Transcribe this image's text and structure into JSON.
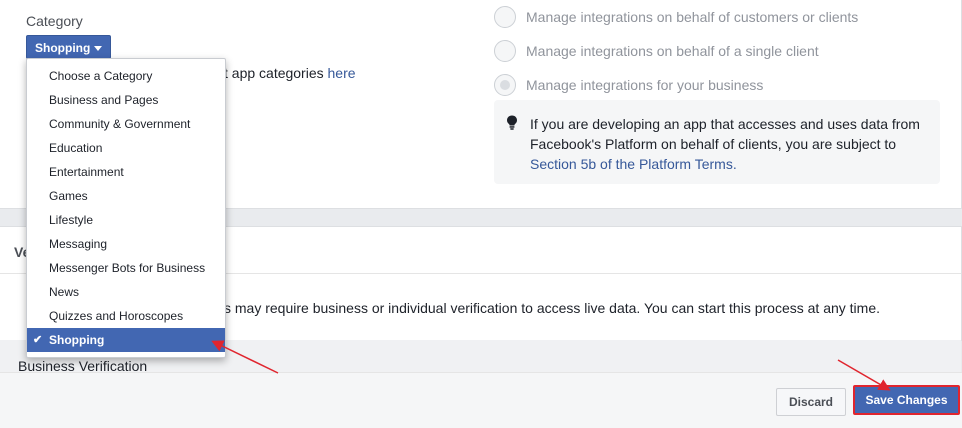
{
  "category": {
    "label": "Category",
    "button_label": "Shopping",
    "learn_more_prefix": "t app categories ",
    "learn_more_link": "here"
  },
  "integrations": {
    "options": [
      "Manage integrations on behalf of customers or clients",
      "Manage integrations on behalf of a single client",
      "Manage integrations for your business"
    ],
    "info_text": "If you are developing an app that accesses and uses data from Facebook's Platform on behalf of clients, you are subject to",
    "info_link": "Section 5b of the Platform Terms."
  },
  "verification": {
    "header_partial": "Ve",
    "text_partial": "s may require business or individual verification to access live data. You can start this process at any time.",
    "business_verification_label": "Business Verification"
  },
  "dropdown": {
    "items": [
      "Choose a Category",
      "Business and Pages",
      "Community & Government",
      "Education",
      "Entertainment",
      "Games",
      "Lifestyle",
      "Messaging",
      "Messenger Bots for Business",
      "News",
      "Quizzes and Horoscopes",
      "Shopping"
    ],
    "selected": "Shopping"
  },
  "footer": {
    "discard_label": "Discard",
    "save_label": "Save Changes"
  },
  "colors": {
    "brand_blue": "#4267b2",
    "annotation_red": "#e0252e"
  }
}
